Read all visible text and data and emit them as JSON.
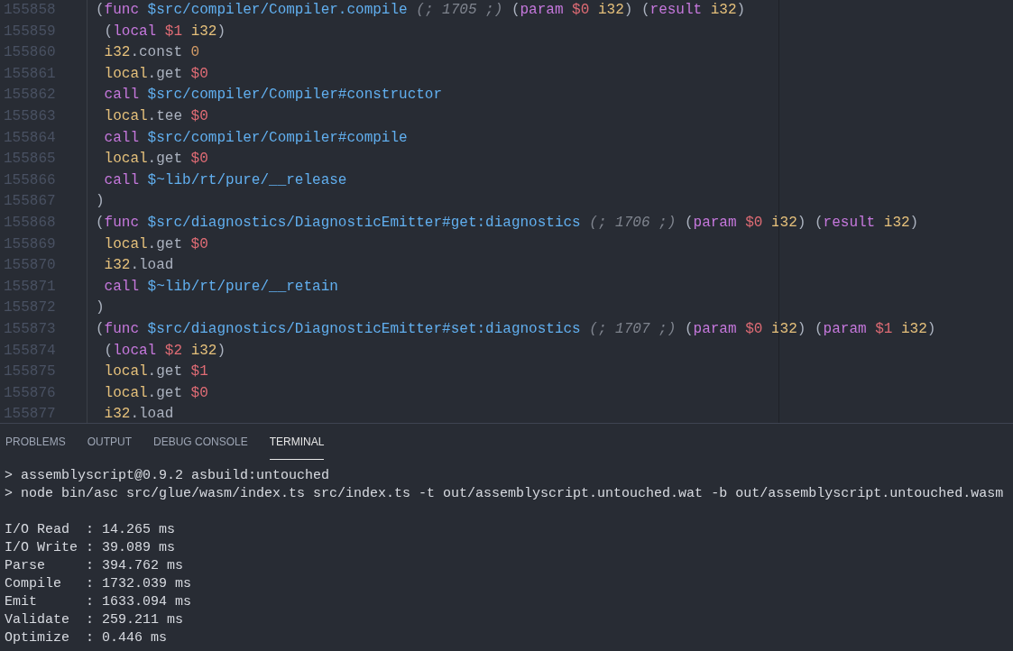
{
  "editor": {
    "lines": [
      {
        "number": "155858",
        "tokens": [
          {
            "kind": "punct",
            "text": "("
          },
          {
            "kind": "keyword",
            "text": "func"
          },
          {
            "kind": "name",
            "text": " $src/compiler/Compiler.compile"
          },
          {
            "kind": "comment",
            "text": " (; 1705 ;)"
          },
          {
            "kind": "plain",
            "text": " ("
          },
          {
            "kind": "keyword",
            "text": "param"
          },
          {
            "kind": "var",
            "text": " $0"
          },
          {
            "kind": "type",
            "text": " i32"
          },
          {
            "kind": "plain",
            "text": ") ("
          },
          {
            "kind": "keyword",
            "text": "result"
          },
          {
            "kind": "type",
            "text": " i32"
          },
          {
            "kind": "plain",
            "text": ")"
          }
        ]
      },
      {
        "number": "155859",
        "tokens": [
          {
            "kind": "plain",
            "text": " ("
          },
          {
            "kind": "keyword",
            "text": "local"
          },
          {
            "kind": "var",
            "text": " $1"
          },
          {
            "kind": "type",
            "text": " i32"
          },
          {
            "kind": "plain",
            "text": ")"
          }
        ]
      },
      {
        "number": "155860",
        "tokens": [
          {
            "kind": "type",
            "text": " i32"
          },
          {
            "kind": "plain",
            "text": ".const"
          },
          {
            "kind": "number",
            "text": " 0"
          }
        ]
      },
      {
        "number": "155861",
        "tokens": [
          {
            "kind": "type",
            "text": " local"
          },
          {
            "kind": "plain",
            "text": ".get"
          },
          {
            "kind": "var",
            "text": " $0"
          }
        ]
      },
      {
        "number": "155862",
        "tokens": [
          {
            "kind": "keyword",
            "text": " call"
          },
          {
            "kind": "name",
            "text": " $src/compiler/Compiler#constructor"
          }
        ]
      },
      {
        "number": "155863",
        "tokens": [
          {
            "kind": "type",
            "text": " local"
          },
          {
            "kind": "plain",
            "text": ".tee"
          },
          {
            "kind": "var",
            "text": " $0"
          }
        ]
      },
      {
        "number": "155864",
        "tokens": [
          {
            "kind": "keyword",
            "text": " call"
          },
          {
            "kind": "name",
            "text": " $src/compiler/Compiler#compile"
          }
        ]
      },
      {
        "number": "155865",
        "tokens": [
          {
            "kind": "type",
            "text": " local"
          },
          {
            "kind": "plain",
            "text": ".get"
          },
          {
            "kind": "var",
            "text": " $0"
          }
        ]
      },
      {
        "number": "155866",
        "tokens": [
          {
            "kind": "keyword",
            "text": " call"
          },
          {
            "kind": "name",
            "text": " $~lib/rt/pure/__release"
          }
        ]
      },
      {
        "number": "155867",
        "tokens": [
          {
            "kind": "plain",
            "text": ")"
          }
        ]
      },
      {
        "number": "155868",
        "tokens": [
          {
            "kind": "punct",
            "text": "("
          },
          {
            "kind": "keyword",
            "text": "func"
          },
          {
            "kind": "name",
            "text": " $src/diagnostics/DiagnosticEmitter#get:diagnostics"
          },
          {
            "kind": "comment",
            "text": " (; 1706 ;)"
          },
          {
            "kind": "plain",
            "text": " ("
          },
          {
            "kind": "keyword",
            "text": "param"
          },
          {
            "kind": "var",
            "text": " $0"
          },
          {
            "kind": "type",
            "text": " i32"
          },
          {
            "kind": "plain",
            "text": ") ("
          },
          {
            "kind": "keyword",
            "text": "result"
          },
          {
            "kind": "type",
            "text": " i32"
          },
          {
            "kind": "plain",
            "text": ")"
          }
        ]
      },
      {
        "number": "155869",
        "tokens": [
          {
            "kind": "type",
            "text": " local"
          },
          {
            "kind": "plain",
            "text": ".get"
          },
          {
            "kind": "var",
            "text": " $0"
          }
        ]
      },
      {
        "number": "155870",
        "tokens": [
          {
            "kind": "type",
            "text": " i32"
          },
          {
            "kind": "plain",
            "text": ".load"
          }
        ]
      },
      {
        "number": "155871",
        "tokens": [
          {
            "kind": "keyword",
            "text": " call"
          },
          {
            "kind": "name",
            "text": " $~lib/rt/pure/__retain"
          }
        ]
      },
      {
        "number": "155872",
        "tokens": [
          {
            "kind": "plain",
            "text": ")"
          }
        ]
      },
      {
        "number": "155873",
        "tokens": [
          {
            "kind": "punct",
            "text": "("
          },
          {
            "kind": "keyword",
            "text": "func"
          },
          {
            "kind": "name",
            "text": " $src/diagnostics/DiagnosticEmitter#set:diagnostics"
          },
          {
            "kind": "comment",
            "text": " (; 1707 ;)"
          },
          {
            "kind": "plain",
            "text": " ("
          },
          {
            "kind": "keyword",
            "text": "param"
          },
          {
            "kind": "var",
            "text": " $0"
          },
          {
            "kind": "type",
            "text": " i32"
          },
          {
            "kind": "plain",
            "text": ") ("
          },
          {
            "kind": "keyword",
            "text": "param"
          },
          {
            "kind": "var",
            "text": " $1"
          },
          {
            "kind": "type",
            "text": " i32"
          },
          {
            "kind": "plain",
            "text": ")"
          }
        ]
      },
      {
        "number": "155874",
        "tokens": [
          {
            "kind": "plain",
            "text": " ("
          },
          {
            "kind": "keyword",
            "text": "local"
          },
          {
            "kind": "var",
            "text": " $2"
          },
          {
            "kind": "type",
            "text": " i32"
          },
          {
            "kind": "plain",
            "text": ")"
          }
        ]
      },
      {
        "number": "155875",
        "tokens": [
          {
            "kind": "type",
            "text": " local"
          },
          {
            "kind": "plain",
            "text": ".get"
          },
          {
            "kind": "var",
            "text": " $1"
          }
        ]
      },
      {
        "number": "155876",
        "tokens": [
          {
            "kind": "type",
            "text": " local"
          },
          {
            "kind": "plain",
            "text": ".get"
          },
          {
            "kind": "var",
            "text": " $0"
          }
        ]
      },
      {
        "number": "155877",
        "tokens": [
          {
            "kind": "type",
            "text": " i32"
          },
          {
            "kind": "plain",
            "text": ".load"
          }
        ]
      }
    ]
  },
  "panel": {
    "tabs": [
      {
        "label": "PROBLEMS",
        "selected": false
      },
      {
        "label": "OUTPUT",
        "selected": false
      },
      {
        "label": "DEBUG CONSOLE",
        "selected": false
      },
      {
        "label": "TERMINAL",
        "selected": true
      }
    ],
    "terminal_blocks": [
      [
        "> assemblyscript@0.9.2 asbuild:untouched",
        "> node bin/asc src/glue/wasm/index.ts src/index.ts -t out/assemblyscript.untouched.wat -b out/assemblyscript.untouched.wasm"
      ],
      [
        "I/O Read  : 14.265 ms",
        "I/O Write : 39.089 ms",
        "Parse     : 394.762 ms",
        "Compile   : 1732.039 ms",
        "Emit      : 1633.094 ms",
        "Validate  : 259.211 ms",
        "Optimize  : 0.446 ms"
      ]
    ]
  }
}
